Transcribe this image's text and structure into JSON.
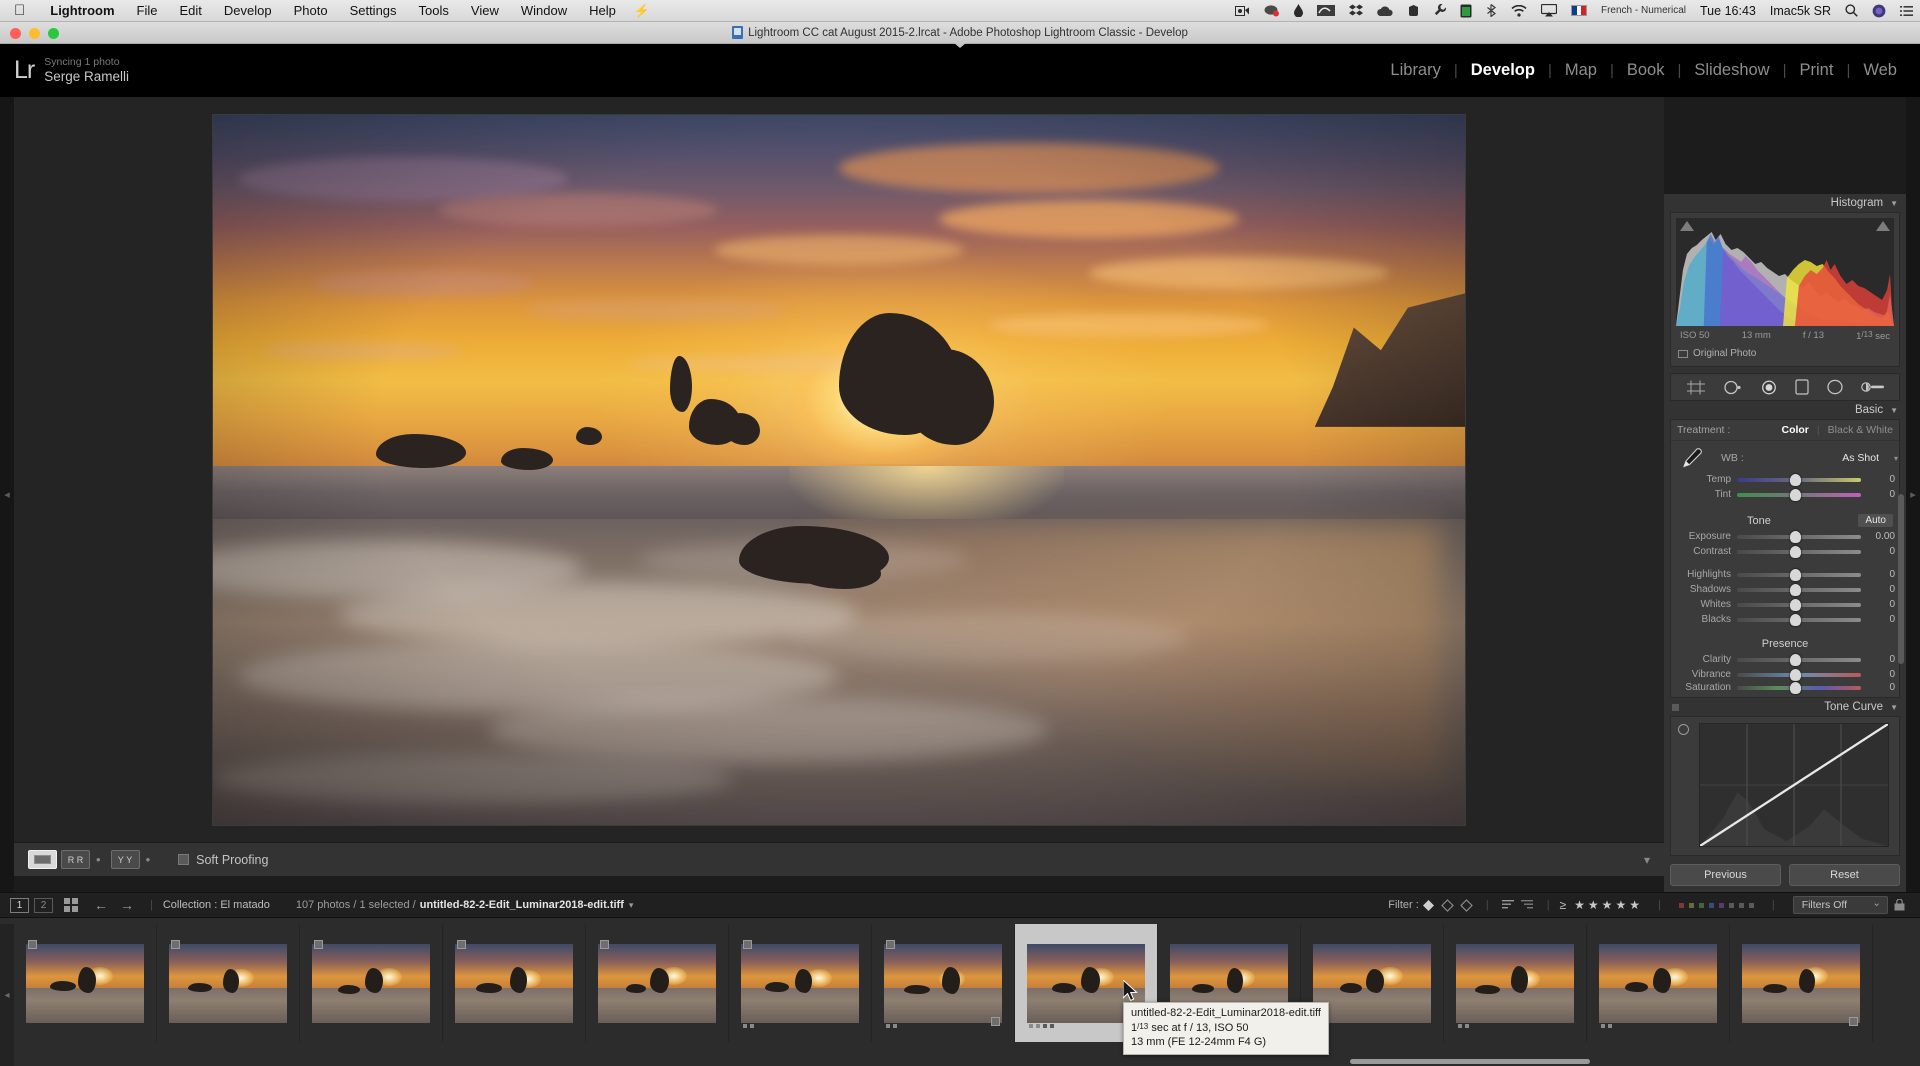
{
  "macbar": {
    "apple_icon": "apple-logo-icon",
    "items": [
      "Lightroom",
      "File",
      "Edit",
      "Develop",
      "Photo",
      "Settings",
      "Tools",
      "View",
      "Window",
      "Help"
    ],
    "app_name": "Lightroom",
    "bolt_icon": "bolt-icon",
    "status_icons": [
      "screen-record-icon",
      "cloud-sync-icon",
      "ink-drop-icon",
      "nvidia-icon",
      "dropbox-icon",
      "onedrive-icon",
      "evernote-icon",
      "wrench-icon",
      "battery-icon",
      "bluetooth-icon",
      "wifi-icon",
      "airplay-icon"
    ],
    "input_source": "French - Numerical",
    "clock": "Tue 16:43",
    "user": "Imac5k SR",
    "search_icon": "search-icon",
    "siri_icon": "siri-icon",
    "notification_icon": "notification-center-icon"
  },
  "window": {
    "title": "Lightroom CC cat August 2015-2.lrcat - Adobe Photoshop Lightroom Classic - Develop",
    "doc_icon": "document-icon"
  },
  "topbar": {
    "logo": "Lr",
    "sync_status": "Syncing 1 photo",
    "user_name": "Serge Ramelli",
    "modules": [
      {
        "label": "Library",
        "active": false
      },
      {
        "label": "Develop",
        "active": true
      },
      {
        "label": "Map",
        "active": false
      },
      {
        "label": "Book",
        "active": false
      },
      {
        "label": "Slideshow",
        "active": false
      },
      {
        "label": "Print",
        "active": false
      },
      {
        "label": "Web",
        "active": false
      }
    ],
    "separator": "|"
  },
  "image_toolbar": {
    "view_loupe": "loupe-view-button",
    "view_before_after": "before-after-button",
    "view_yy": "yy-compare-button",
    "soft_proofing_label": "Soft Proofing",
    "dot": "•"
  },
  "right_panel": {
    "histogram": {
      "title": "Histogram",
      "caret": "▼",
      "iso": "ISO 50",
      "focal": "13 mm",
      "aperture": "f / 13",
      "shutter_num": "1",
      "shutter_den": "13",
      "shutter_suffix": "sec",
      "original_photo": "Original Photo"
    },
    "toolstrip": [
      "crop-overlay-icon",
      "spot-removal-icon",
      "red-eye-icon",
      "graduated-filter-icon",
      "radial-filter-icon",
      "adjustment-brush-icon"
    ],
    "basic": {
      "title": "Basic",
      "caret": "▼",
      "treatment_label": "Treatment :",
      "treatment_color": "Color",
      "treatment_bw": "Black & White",
      "wb_label": "WB :",
      "wb_value": "As Shot",
      "eyedropper": "white-balance-selector-icon",
      "sliders_wb": [
        {
          "name": "Temp",
          "value": "0"
        },
        {
          "name": "Tint",
          "value": "0"
        }
      ],
      "tone_title": "Tone",
      "auto_label": "Auto",
      "sliders_tone": [
        {
          "name": "Exposure",
          "value": "0.00"
        },
        {
          "name": "Contrast",
          "value": "0"
        }
      ],
      "sliders_tone2": [
        {
          "name": "Highlights",
          "value": "0"
        },
        {
          "name": "Shadows",
          "value": "0"
        },
        {
          "name": "Whites",
          "value": "0"
        },
        {
          "name": "Blacks",
          "value": "0"
        }
      ],
      "presence_title": "Presence",
      "sliders_presence": [
        {
          "name": "Clarity",
          "value": "0"
        },
        {
          "name": "Vibrance",
          "value": "0"
        },
        {
          "name": "Saturation",
          "value": "0"
        }
      ]
    },
    "tone_curve": {
      "title": "Tone Curve",
      "caret": "▼",
      "target_adjust": "target-adjustment-icon"
    },
    "previous_label": "Previous",
    "reset_label": "Reset"
  },
  "filmstrip_toolbar": {
    "screen1": "1",
    "screen2": "2",
    "grid_icon": "grid-view-icon",
    "back_icon": "navigate-back-icon",
    "forward_icon": "navigate-forward-icon",
    "collection": "Collection : El matado",
    "count": "107 photos / 1 selected /",
    "filename": "untitled-82-2-Edit_Luminar2018-edit.tiff",
    "caret": "▾",
    "filter_label": "Filter :",
    "flags": [
      "flag-pick-icon",
      "flag-unflagged-icon",
      "flag-rejected-icon"
    ],
    "sort_icons": [
      "sort-ascending-icon",
      "sort-custom-icon"
    ],
    "rating_prefix": "≥",
    "stars": [
      "★",
      "★",
      "★",
      "★",
      "★"
    ],
    "color_labels": [
      "red",
      "yellow",
      "green",
      "blue",
      "purple",
      "none",
      "custom",
      "edited"
    ],
    "filters_off": "Filters Off"
  },
  "tooltip": {
    "filename": "untitled-82-2-Edit_Luminar2018-edit.tiff",
    "exposure_num": "1",
    "exposure_den": "13",
    "exposure_rest": " sec at f / 13, ISO 50",
    "lens": "13 mm (FE 12-24mm F4 G)"
  },
  "thumbnails": [
    {
      "id": 1,
      "active": false,
      "badge_left": true,
      "badge_right": false,
      "dots": 0
    },
    {
      "id": 2,
      "active": false,
      "badge_left": true,
      "badge_right": false,
      "dots": 0
    },
    {
      "id": 3,
      "active": false,
      "badge_left": true,
      "badge_right": false,
      "dots": 0
    },
    {
      "id": 4,
      "active": false,
      "badge_left": true,
      "badge_right": false,
      "dots": 0
    },
    {
      "id": 5,
      "active": false,
      "badge_left": true,
      "badge_right": false,
      "dots": 0
    },
    {
      "id": 6,
      "active": false,
      "badge_left": true,
      "badge_right": false,
      "dots": 2
    },
    {
      "id": 7,
      "active": false,
      "badge_left": true,
      "badge_right": true,
      "dots": 2
    },
    {
      "id": 8,
      "active": true,
      "badge_left": false,
      "badge_right": false,
      "dots": 4
    },
    {
      "id": 9,
      "active": false,
      "badge_left": false,
      "badge_right": false,
      "dots": 0
    },
    {
      "id": 10,
      "active": false,
      "badge_left": false,
      "badge_right": false,
      "dots": 0
    },
    {
      "id": 11,
      "active": false,
      "badge_left": false,
      "badge_right": false,
      "dots": 2
    },
    {
      "id": 12,
      "active": false,
      "badge_left": false,
      "badge_right": false,
      "dots": 2
    },
    {
      "id": 13,
      "active": false,
      "badge_left": false,
      "badge_right": true,
      "dots": 0
    }
  ],
  "colors": {
    "panel_bg": "#333333",
    "canvas_bg": "#242424",
    "topbar_bg": "#000000",
    "filmstrip_bg": "#2c2c2c",
    "accent_text": "#ffffff"
  }
}
